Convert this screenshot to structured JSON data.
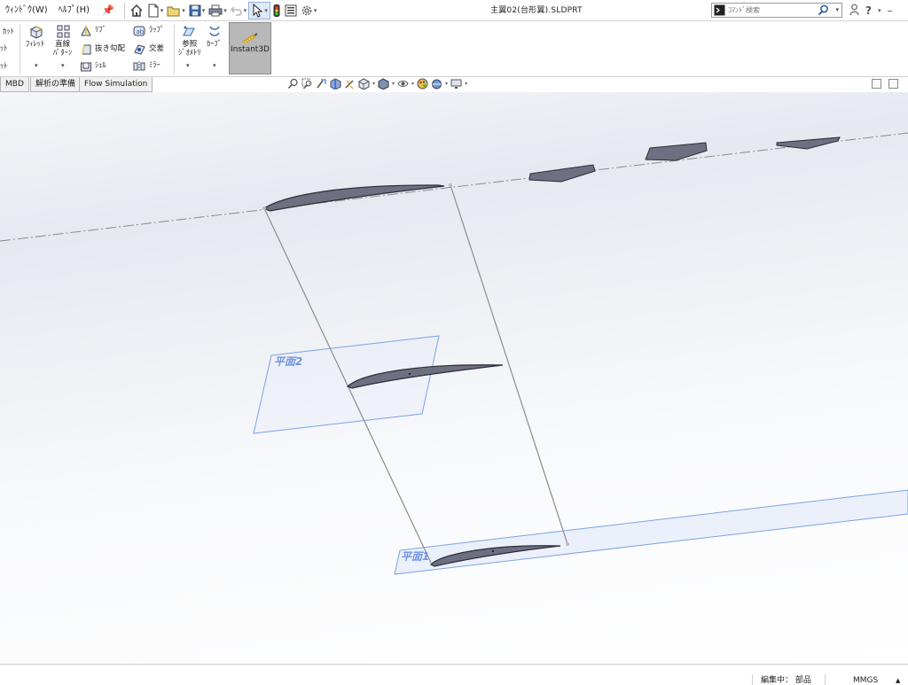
{
  "menu": {
    "window_label": "ｳｨﾝﾄﾞｳ(W)",
    "help_label": "ﾍﾙﾌﾟ(H)"
  },
  "document": {
    "title": "主翼02(台形翼).SLDPRT"
  },
  "search": {
    "placeholder": "ｺﾏﾝﾄﾞ検索"
  },
  "title_right": {
    "help_glyph": "?",
    "minimize_glyph": "–"
  },
  "ribbon": {
    "cut_partial_1": "ｶｯﾄ",
    "cut_partial_2": "ｯﾄ",
    "cut_partial_3": "ｯﾄ",
    "fillet": "ﾌｨﾚｯﾄ",
    "linear_pattern": "直線\nﾊﾟﾀｰﾝ",
    "rib": "ﾘﾌﾞ",
    "draft": "抜き勾配",
    "shell": "ｼｪﾙ",
    "wrap": "ﾗｯﾌﾟ",
    "intersect": "交差",
    "mirror": "ﾐﾗｰ",
    "ref_geometry": "参照\nｼﾞｵﾒﾄﾘ",
    "curves": "ｶｰﾌﾞ",
    "instant3d": "Instant3D"
  },
  "tabs": [
    {
      "label": "MBD"
    },
    {
      "label": "解析の準備"
    },
    {
      "label": "Flow Simulation"
    }
  ],
  "viewport": {
    "plane1_label": "平面1",
    "plane2_label": "平面2"
  },
  "status": {
    "editing": "編集中： 部品",
    "units": "MMGS",
    "units_caret": "▲"
  },
  "colors": {
    "accent_blue": "#1e5aa8",
    "plane_blue": "#6f96e3",
    "airfoil_fill": "#6e7082",
    "instant3d_bg": "#b8b8b8"
  }
}
